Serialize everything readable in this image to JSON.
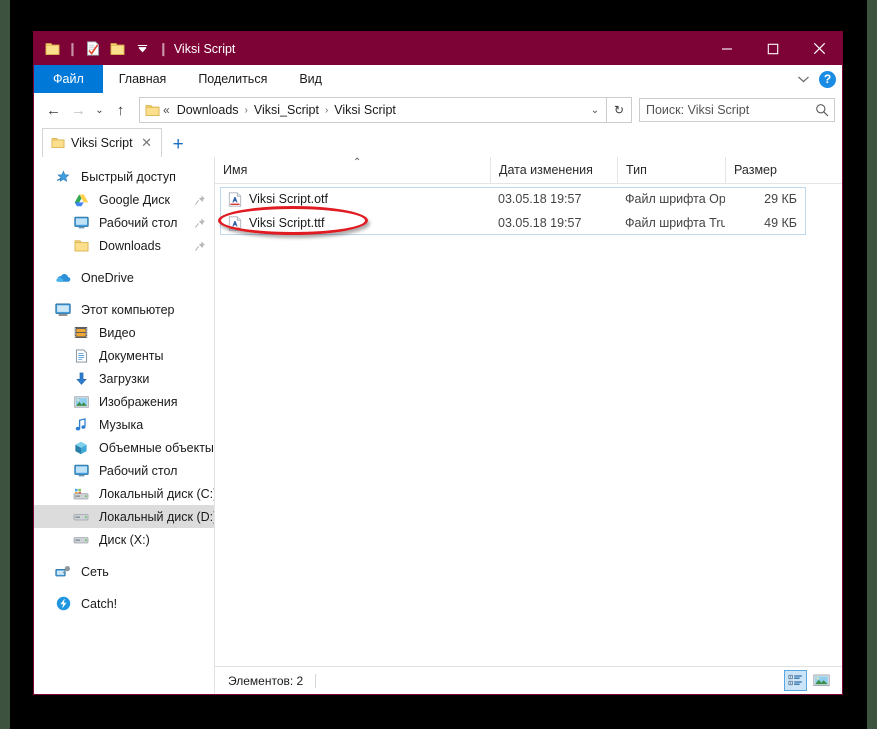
{
  "window": {
    "title": "Viksi Script",
    "titlebar_color": "#7d0235",
    "accent_color": "#0078d7",
    "quick_access_toolbar": [
      {
        "name": "folder-icon",
        "label": "Свойства папки"
      },
      {
        "name": "properties-icon",
        "label": "Свойства"
      },
      {
        "name": "new-folder-icon",
        "label": "Новая папка"
      }
    ],
    "controls": {
      "minimize": "Свернуть",
      "maximize": "Развернуть",
      "close": "Закрыть"
    }
  },
  "ribbon": {
    "tabs": [
      {
        "label": "Файл",
        "active": true
      },
      {
        "label": "Главная",
        "active": false
      },
      {
        "label": "Поделиться",
        "active": false
      },
      {
        "label": "Вид",
        "active": false
      }
    ],
    "expand_label": "⌄",
    "help_label": "?"
  },
  "address": {
    "back_label": "←",
    "forward_label": "→",
    "recent_label": "⌄",
    "up_label": "↑",
    "root_prefix": "«",
    "crumbs": [
      "Downloads",
      "Viksi_Script",
      "Viksi Script"
    ],
    "separator": "›",
    "dropdown_label": "⌄",
    "refresh_label": "↻"
  },
  "search": {
    "value": "Поиск: Viksi Script",
    "placeholder": "Поиск: Viksi Script"
  },
  "tabs": {
    "items": [
      {
        "label": "Viksi Script",
        "close_label": "✕"
      }
    ],
    "new_tab_label": "+"
  },
  "sidebar": {
    "items": [
      {
        "label": "Быстрый доступ",
        "icon": "quick-access-star-icon",
        "level": 0,
        "pinned": false,
        "selected": false
      },
      {
        "label": "Google Диск",
        "icon": "google-drive-icon",
        "level": 1,
        "pinned": true,
        "selected": false
      },
      {
        "label": "Рабочий стол",
        "icon": "desktop-icon",
        "level": 1,
        "pinned": true,
        "selected": false
      },
      {
        "label": "Downloads",
        "icon": "folder-icon",
        "level": 1,
        "pinned": true,
        "selected": false
      },
      {
        "label": "OneDrive",
        "icon": "onedrive-cloud-icon",
        "level": 0,
        "pinned": false,
        "selected": false
      },
      {
        "label": "Этот компьютер",
        "icon": "this-pc-icon",
        "level": 0,
        "pinned": false,
        "selected": false
      },
      {
        "label": "Видео",
        "icon": "videos-icon",
        "level": 1,
        "pinned": false,
        "selected": false
      },
      {
        "label": "Документы",
        "icon": "documents-icon",
        "level": 1,
        "pinned": false,
        "selected": false
      },
      {
        "label": "Загрузки",
        "icon": "downloads-arrow-icon",
        "level": 1,
        "pinned": false,
        "selected": false
      },
      {
        "label": "Изображения",
        "icon": "pictures-icon",
        "level": 1,
        "pinned": false,
        "selected": false
      },
      {
        "label": "Музыка",
        "icon": "music-note-icon",
        "level": 1,
        "pinned": false,
        "selected": false
      },
      {
        "label": "Объемные объекты",
        "icon": "3d-objects-icon",
        "level": 1,
        "pinned": false,
        "selected": false
      },
      {
        "label": "Рабочий стол",
        "icon": "desktop-icon",
        "level": 1,
        "pinned": false,
        "selected": false
      },
      {
        "label": "Локальный диск (C:)",
        "icon": "system-drive-icon",
        "level": 1,
        "pinned": false,
        "selected": false
      },
      {
        "label": "Локальный диск (D:)",
        "icon": "drive-icon",
        "level": 1,
        "pinned": false,
        "selected": true
      },
      {
        "label": "Диск (X:)",
        "icon": "drive-icon",
        "level": 1,
        "pinned": false,
        "selected": false
      },
      {
        "label": "Сеть",
        "icon": "network-icon",
        "level": 0,
        "pinned": false,
        "selected": false
      },
      {
        "label": "Catch!",
        "icon": "catch-icon",
        "level": 0,
        "pinned": false,
        "selected": false
      }
    ]
  },
  "file_list": {
    "columns": [
      {
        "label": "Имя",
        "key": "name"
      },
      {
        "label": "Дата изменения",
        "key": "date"
      },
      {
        "label": "Тип",
        "key": "type"
      },
      {
        "label": "Размер",
        "key": "size"
      }
    ],
    "sort_column": "Имя",
    "sort_caret": "⌃",
    "rows": [
      {
        "name": "Viksi Script.otf",
        "date": "03.05.18 19:57",
        "type": "Файл шрифта Op...",
        "size": "29 КБ",
        "icon": "font-file-icon",
        "annotated": false
      },
      {
        "name": "Viksi Script.ttf",
        "date": "03.05.18 19:57",
        "type": "Файл шрифта Tru...",
        "size": "49 КБ",
        "icon": "font-file-icon",
        "annotated": true
      }
    ],
    "annotation_color": "#e01b22"
  },
  "status_bar": {
    "items_text": "Элементов: 2",
    "view_buttons": [
      {
        "name": "details-view-button",
        "label": "Таблица",
        "active": true
      },
      {
        "name": "large-icons-view-button",
        "label": "Крупные значки",
        "active": false
      }
    ]
  }
}
